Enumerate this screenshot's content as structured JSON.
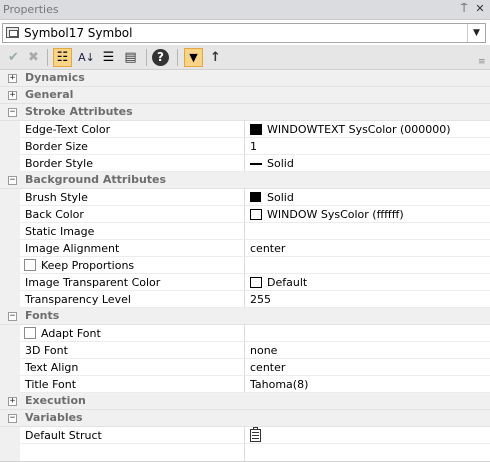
{
  "window": {
    "title": "Properties",
    "pin_glyph": "⍑",
    "close_glyph": "✕"
  },
  "selector": {
    "value": "Symbol17 Symbol",
    "dropdown_glyph": "▼"
  },
  "toolbar": {
    "buttons": [
      {
        "name": "apply-check-icon",
        "glyph": "✔"
      },
      {
        "name": "cancel-x-icon",
        "glyph": "✖"
      },
      {
        "name": "categorized-icon",
        "glyph": "☷"
      },
      {
        "name": "alphabetical-icon",
        "glyph": "A↓"
      },
      {
        "name": "property-pages-icon",
        "glyph": "☰"
      },
      {
        "name": "comment-icon",
        "glyph": "▤"
      },
      {
        "name": "help-icon",
        "glyph": "?"
      },
      {
        "name": "filter-icon",
        "glyph": "▼"
      },
      {
        "name": "up-arrow-icon",
        "glyph": "↑"
      }
    ]
  },
  "colors": {
    "black_swatch": "#000000",
    "white_swatch": "#ffffff",
    "active_button_bg": "#f8d486",
    "category_text": "#6d6d6d"
  },
  "categories": {
    "dynamics": {
      "label": "Dynamics",
      "state": "+"
    },
    "general": {
      "label": "General",
      "state": "+"
    },
    "stroke": {
      "label": "Stroke Attributes",
      "state": "−"
    },
    "background": {
      "label": "Background Attributes",
      "state": "−"
    },
    "fonts": {
      "label": "Fonts",
      "state": "−"
    },
    "execution": {
      "label": "Execution",
      "state": "+"
    },
    "variables": {
      "label": "Variables",
      "state": "−"
    }
  },
  "properties": {
    "edge_text_color": {
      "name": "Edge-Text Color",
      "value": "WINDOWTEXT SysColor (000000)"
    },
    "border_size": {
      "name": "Border Size",
      "value": "1"
    },
    "border_style": {
      "name": "Border Style",
      "value": "Solid"
    },
    "brush_style": {
      "name": "Brush Style",
      "value": "Solid"
    },
    "back_color": {
      "name": "Back Color",
      "value": "WINDOW SysColor (ffffff)"
    },
    "static_image": {
      "name": "Static Image",
      "value": ""
    },
    "image_alignment": {
      "name": "Image Alignment",
      "value": "center"
    },
    "keep_proportions": {
      "name": "Keep Proportions",
      "value": ""
    },
    "image_transparent_color": {
      "name": "Image Transparent Color",
      "value": "Default"
    },
    "transparency_level": {
      "name": "Transparency Level",
      "value": "255"
    },
    "adapt_font": {
      "name": "Adapt Font",
      "value": ""
    },
    "font_3d": {
      "name": "3D Font",
      "value": "none"
    },
    "text_align": {
      "name": "Text Align",
      "value": "center"
    },
    "title_font": {
      "name": "Title Font",
      "value": "Tahoma(8)"
    },
    "default_struct": {
      "name": "Default Struct",
      "value": ""
    }
  }
}
